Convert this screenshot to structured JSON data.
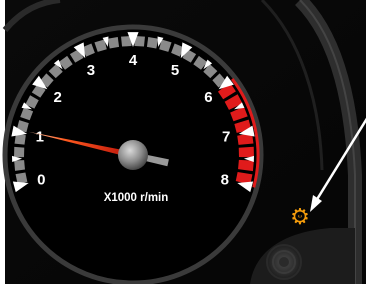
{
  "gauge": {
    "type": "tachometer",
    "unit_label": "X1000 r/min",
    "scale_labels": [
      "0",
      "1",
      "2",
      "3",
      "4",
      "5",
      "6",
      "7",
      "8"
    ],
    "scale_min": 0,
    "scale_max": 8,
    "redline_start": 6,
    "needle_value": 1.05,
    "colors": {
      "dial_face": "#000000",
      "bezel": "#3a3a3a",
      "normal_ticks": "#8a8a8a",
      "major_ticks": "#ffffff",
      "redline": "#e01b1b",
      "needle": "#e8321e",
      "labels": "#ffffff"
    }
  },
  "warning_light": {
    "icon": "gear-exclamation-icon",
    "symbol": "⚙",
    "state": "illuminated",
    "color": "#f59c0b"
  },
  "callout": {
    "icon": "arrow-icon",
    "color": "#ffffff"
  }
}
